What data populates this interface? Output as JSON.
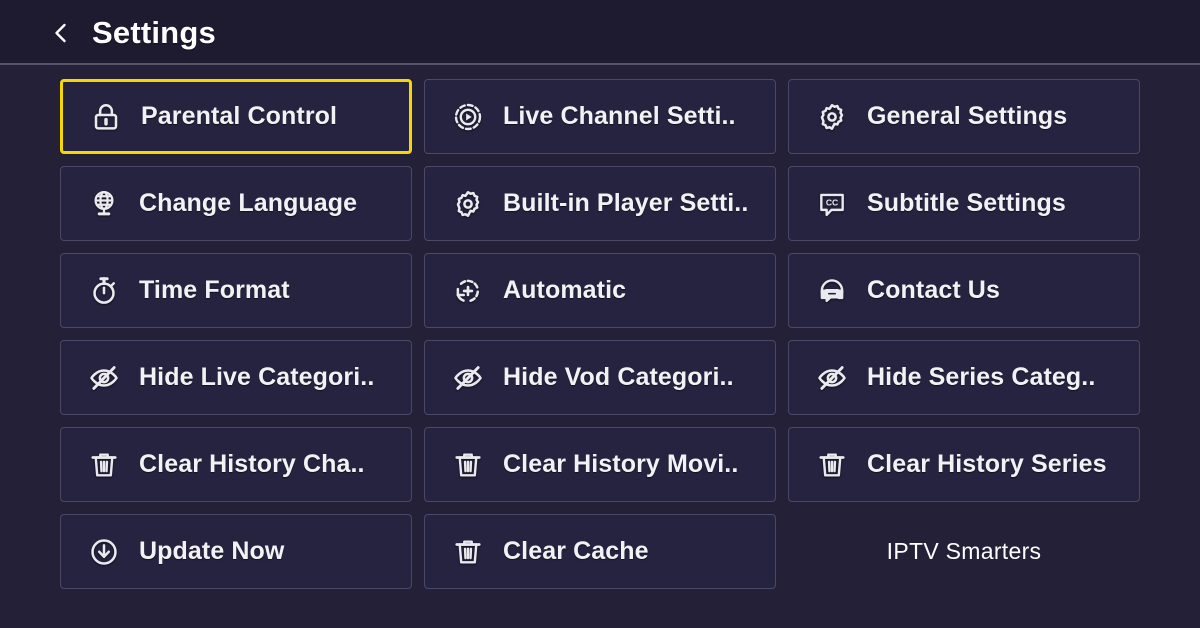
{
  "header": {
    "title": "Settings",
    "back_icon": "chevron-left-icon"
  },
  "colors": {
    "page_background": "#232038",
    "header_background": "#1e1b30",
    "tile_background": "#262340",
    "tile_border": "#4b4766",
    "focus_border": "#f5d800",
    "divider": "#55556a",
    "text": "#f2f2f5"
  },
  "grid": {
    "columns": 3,
    "rows": 6,
    "tiles": [
      {
        "id": "parental-control",
        "label": "Parental Control",
        "icon": "lock-icon",
        "focused": true
      },
      {
        "id": "live-channel-settings",
        "label": "Live Channel Setti..",
        "icon": "play-circle-icon",
        "focused": false
      },
      {
        "id": "general-settings",
        "label": "General Settings",
        "icon": "gear-icon",
        "focused": false
      },
      {
        "id": "change-language",
        "label": "Change Language",
        "icon": "globe-icon",
        "focused": false
      },
      {
        "id": "built-in-player",
        "label": "Built-in Player Setti..",
        "icon": "gear-icon",
        "focused": false
      },
      {
        "id": "subtitle-settings",
        "label": "Subtitle Settings",
        "icon": "closed-caption-icon",
        "focused": false
      },
      {
        "id": "time-format",
        "label": "Time Format",
        "icon": "stopwatch-icon",
        "focused": false
      },
      {
        "id": "automatic",
        "label": "Automatic",
        "icon": "auto-refresh-icon",
        "focused": false
      },
      {
        "id": "contact-us",
        "label": "Contact Us",
        "icon": "headset-support-icon",
        "focused": false
      },
      {
        "id": "hide-live-categories",
        "label": "Hide Live Categori..",
        "icon": "eye-off-icon",
        "focused": false
      },
      {
        "id": "hide-vod-categories",
        "label": "Hide Vod Categori..",
        "icon": "eye-off-icon",
        "focused": false
      },
      {
        "id": "hide-series-categories",
        "label": "Hide Series Categ..",
        "icon": "eye-off-icon",
        "focused": false
      },
      {
        "id": "clear-history-channels",
        "label": "Clear History Cha..",
        "icon": "trash-icon",
        "focused": false
      },
      {
        "id": "clear-history-movies",
        "label": "Clear History Movi..",
        "icon": "trash-icon",
        "focused": false
      },
      {
        "id": "clear-history-series",
        "label": "Clear History Series",
        "icon": "trash-icon",
        "focused": false
      },
      {
        "id": "update-now",
        "label": "Update Now",
        "icon": "download-circle-icon",
        "focused": false
      },
      {
        "id": "clear-cache",
        "label": "Clear Cache",
        "icon": "trash-icon",
        "focused": false
      }
    ]
  },
  "watermark": {
    "text": "IPTV Smarters"
  }
}
